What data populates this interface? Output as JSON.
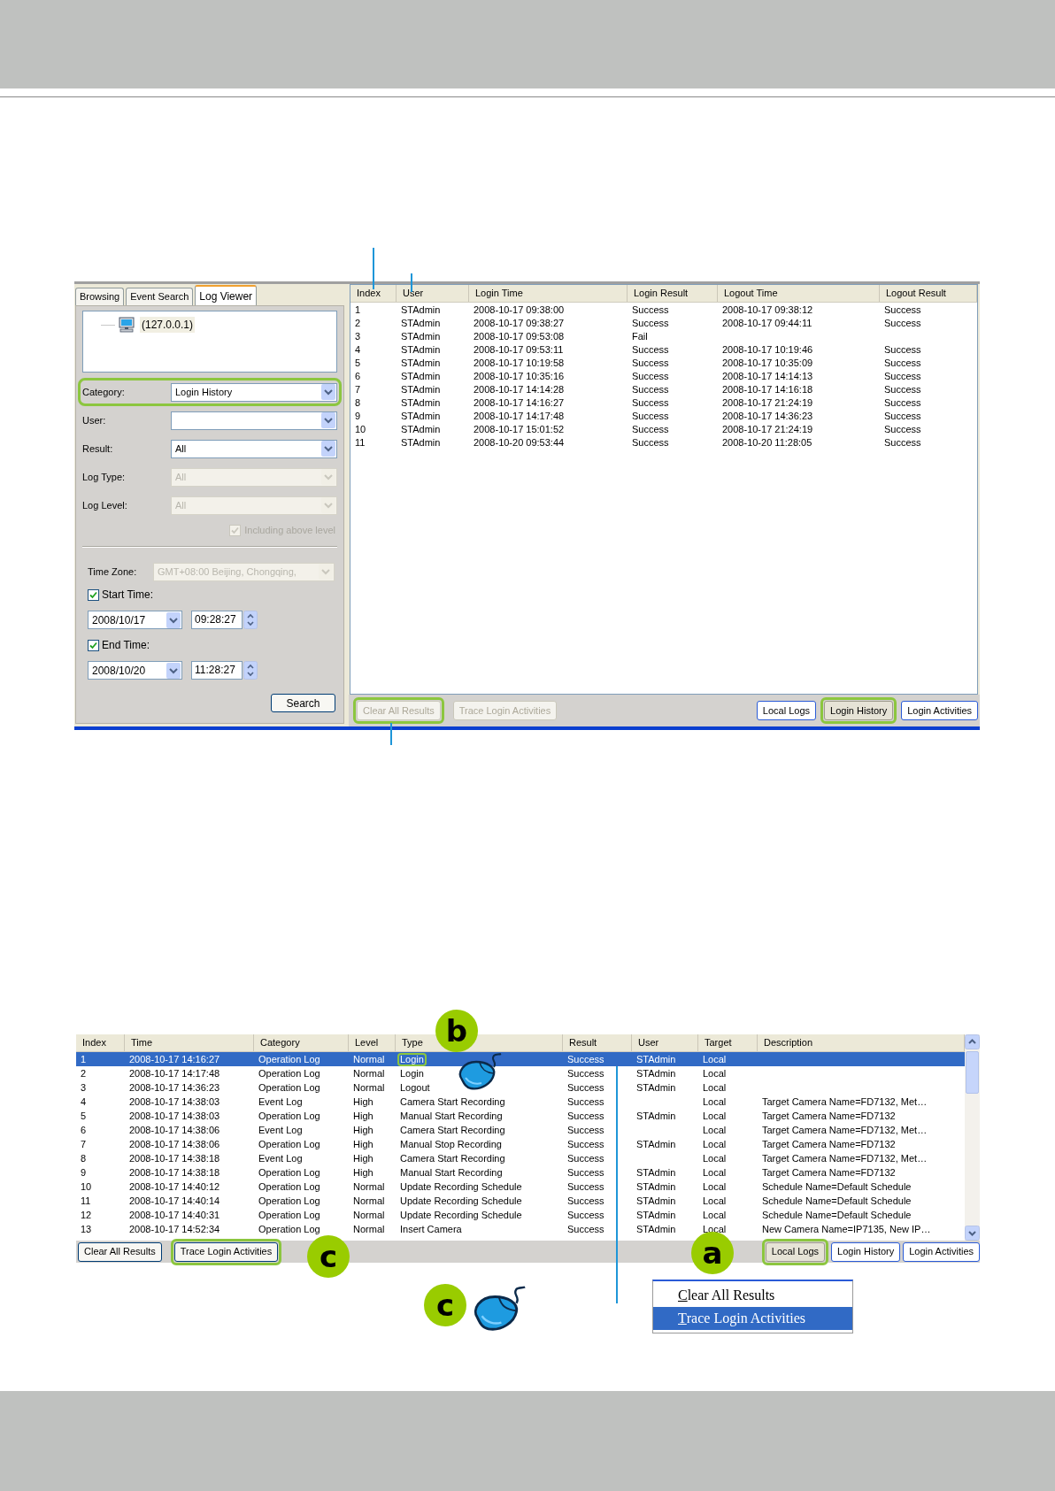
{
  "log_viewer": {
    "tabs": [
      {
        "label": "Browsing",
        "selected": false
      },
      {
        "label": "Event Search",
        "selected": false
      },
      {
        "label": "Log Viewer",
        "selected": true
      }
    ],
    "tree": [
      {
        "label": "(127.0.0.1)"
      }
    ],
    "filters": [
      {
        "label": "Category:",
        "value": "Login History",
        "disabled": false,
        "highlighted": true
      },
      {
        "label": "User:",
        "disabled": false,
        "highlighted": false
      },
      {
        "label": "Result:",
        "value": "All",
        "disabled": false,
        "highlighted": false
      },
      {
        "label": "Log Type:",
        "value": "All",
        "disabled": true,
        "highlighted": false
      },
      {
        "label": "Log Level:",
        "value": "All",
        "disabled": true,
        "highlighted": false
      }
    ],
    "including_above_level": {
      "label": "Including above level",
      "checked": true,
      "disabled": true
    },
    "time_zone": {
      "label": "Time Zone:",
      "value": "GMT+08:00 Beijing, Chongqing,",
      "disabled": true
    },
    "time_range": [
      {
        "label": "Start Time:",
        "checked": true,
        "date": "2008/10/17",
        "time": "09:28:27"
      },
      {
        "label": "End Time:",
        "checked": true,
        "date": "2008/10/20",
        "time": "11:28:27"
      }
    ],
    "search_button": "Search",
    "table": {
      "columns": [
        "Index",
        "User",
        "Login Time",
        "Login Result",
        "Logout Time",
        "Logout Result"
      ],
      "rows": [
        {
          "index": "1",
          "user": "STAdmin",
          "login_time": "2008-10-17 09:38:00",
          "login_result": "Success",
          "logout_time": "2008-10-17 09:38:12",
          "logout_result": "Success"
        },
        {
          "index": "2",
          "user": "STAdmin",
          "login_time": "2008-10-17 09:38:27",
          "login_result": "Success",
          "logout_time": "2008-10-17 09:44:11",
          "logout_result": "Success"
        },
        {
          "index": "3",
          "user": "STAdmin",
          "login_time": "2008-10-17 09:53:08",
          "login_result": "Fail"
        },
        {
          "index": "4",
          "user": "STAdmin",
          "login_time": "2008-10-17 09:53:11",
          "login_result": "Success",
          "logout_time": "2008-10-17 10:19:46",
          "logout_result": "Success"
        },
        {
          "index": "5",
          "user": "STAdmin",
          "login_time": "2008-10-17 10:19:58",
          "login_result": "Success",
          "logout_time": "2008-10-17 10:35:09",
          "logout_result": "Success"
        },
        {
          "index": "6",
          "user": "STAdmin",
          "login_time": "2008-10-17 10:35:16",
          "login_result": "Success",
          "logout_time": "2008-10-17 14:14:13",
          "logout_result": "Success"
        },
        {
          "index": "7",
          "user": "STAdmin",
          "login_time": "2008-10-17 14:14:28",
          "login_result": "Success",
          "logout_time": "2008-10-17 14:16:18",
          "logout_result": "Success"
        },
        {
          "index": "8",
          "user": "STAdmin",
          "login_time": "2008-10-17 14:16:27",
          "login_result": "Success",
          "logout_time": "2008-10-17 21:24:19",
          "logout_result": "Success"
        },
        {
          "index": "9",
          "user": "STAdmin",
          "login_time": "2008-10-17 14:17:48",
          "login_result": "Success",
          "logout_time": "2008-10-17 14:36:23",
          "logout_result": "Success"
        },
        {
          "index": "10",
          "user": "STAdmin",
          "login_time": "2008-10-17 15:01:52",
          "login_result": "Success",
          "logout_time": "2008-10-17 21:24:19",
          "logout_result": "Success"
        },
        {
          "index": "11",
          "user": "STAdmin",
          "login_time": "2008-10-20 09:53:44",
          "login_result": "Success",
          "logout_time": "2008-10-20 11:28:05",
          "logout_result": "Success"
        }
      ]
    },
    "actions": [
      {
        "label": "Clear All Results",
        "disabled": true,
        "highlighted": true
      },
      {
        "label": "Trace Login Activities",
        "disabled": true,
        "highlighted": false
      }
    ],
    "views": [
      {
        "label": "Local Logs",
        "selected": false,
        "highlighted": false
      },
      {
        "label": "Login History",
        "selected": true,
        "highlighted": true
      },
      {
        "label": "Login Activities",
        "selected": false,
        "highlighted": false
      }
    ]
  },
  "local_logs": {
    "table": {
      "columns": [
        "Index",
        "Time",
        "Category",
        "Level",
        "Type",
        "Result",
        "User",
        "Target",
        "Description"
      ],
      "rows": [
        {
          "selected": true,
          "type_highlighted": true,
          "index": "1",
          "time": "2008-10-17 14:16:27",
          "category": "Operation Log",
          "level": "Normal",
          "type": "Login",
          "result": "Success",
          "user": "STAdmin",
          "target": "Local"
        },
        {
          "selected": false,
          "index": "2",
          "time": "2008-10-17 14:17:48",
          "category": "Operation Log",
          "level": "Normal",
          "type": "Login",
          "result": "Success",
          "user": "STAdmin",
          "target": "Local"
        },
        {
          "selected": false,
          "index": "3",
          "time": "2008-10-17 14:36:23",
          "category": "Operation Log",
          "level": "Normal",
          "type": "Logout",
          "result": "Success",
          "user": "STAdmin",
          "target": "Local"
        },
        {
          "selected": false,
          "index": "4",
          "time": "2008-10-17 14:38:03",
          "category": "Event Log",
          "level": "High",
          "type": "Camera Start Recording",
          "result": "Success",
          "target": "Local",
          "description": "Target Camera Name=FD7132, Met…"
        },
        {
          "selected": false,
          "index": "5",
          "time": "2008-10-17 14:38:03",
          "category": "Operation Log",
          "level": "High",
          "type": "Manual Start Recording",
          "result": "Success",
          "user": "STAdmin",
          "target": "Local",
          "description": "Target Camera Name=FD7132"
        },
        {
          "selected": false,
          "index": "6",
          "time": "2008-10-17 14:38:06",
          "category": "Event Log",
          "level": "High",
          "type": "Camera Start Recording",
          "result": "Success",
          "target": "Local",
          "description": "Target Camera Name=FD7132, Met…"
        },
        {
          "selected": false,
          "index": "7",
          "time": "2008-10-17 14:38:06",
          "category": "Operation Log",
          "level": "High",
          "type": "Manual Stop Recording",
          "result": "Success",
          "user": "STAdmin",
          "target": "Local",
          "description": "Target Camera Name=FD7132"
        },
        {
          "selected": false,
          "index": "8",
          "time": "2008-10-17 14:38:18",
          "category": "Event Log",
          "level": "High",
          "type": "Camera Start Recording",
          "result": "Success",
          "target": "Local",
          "description": "Target Camera Name=FD7132, Met…"
        },
        {
          "selected": false,
          "index": "9",
          "time": "2008-10-17 14:38:18",
          "category": "Operation Log",
          "level": "High",
          "type": "Manual Start Recording",
          "result": "Success",
          "user": "STAdmin",
          "target": "Local",
          "description": "Target Camera Name=FD7132"
        },
        {
          "selected": false,
          "index": "10",
          "time": "2008-10-17 14:40:12",
          "category": "Operation Log",
          "level": "Normal",
          "type": "Update Recording Schedule",
          "result": "Success",
          "user": "STAdmin",
          "target": "Local",
          "description": "Schedule Name=Default Schedule"
        },
        {
          "selected": false,
          "index": "11",
          "time": "2008-10-17 14:40:14",
          "category": "Operation Log",
          "level": "Normal",
          "type": "Update Recording Schedule",
          "result": "Success",
          "user": "STAdmin",
          "target": "Local",
          "description": "Schedule Name=Default Schedule"
        },
        {
          "selected": false,
          "index": "12",
          "time": "2008-10-17 14:40:31",
          "category": "Operation Log",
          "level": "Normal",
          "type": "Update Recording Schedule",
          "result": "Success",
          "user": "STAdmin",
          "target": "Local",
          "description": "Schedule Name=Default Schedule"
        },
        {
          "selected": false,
          "index": "13",
          "time": "2008-10-17 14:52:34",
          "category": "Operation Log",
          "level": "Normal",
          "type": "Insert Camera",
          "result": "Success",
          "user": "STAdmin",
          "target": "Local",
          "description": "New Camera Name=IP7135, New IP…"
        }
      ]
    },
    "actions": [
      {
        "label": "Clear All Results",
        "disabled": false,
        "highlighted": false
      },
      {
        "label": "Trace Login Activities",
        "disabled": false,
        "highlighted": true
      }
    ],
    "views": [
      {
        "label": "Local Logs",
        "selected": true,
        "highlighted": true
      },
      {
        "label": "Login History",
        "selected": false,
        "highlighted": false
      },
      {
        "label": "Login Activities",
        "selected": false,
        "highlighted": false
      }
    ]
  },
  "callouts": [
    {
      "label": "b"
    },
    {
      "label": "c"
    },
    {
      "label": "a"
    },
    {
      "label": "c"
    }
  ],
  "context_menu": {
    "items": [
      {
        "label": "Clear All Results",
        "selected": false
      },
      {
        "label": "Trace Login Activities",
        "selected": true
      }
    ]
  }
}
